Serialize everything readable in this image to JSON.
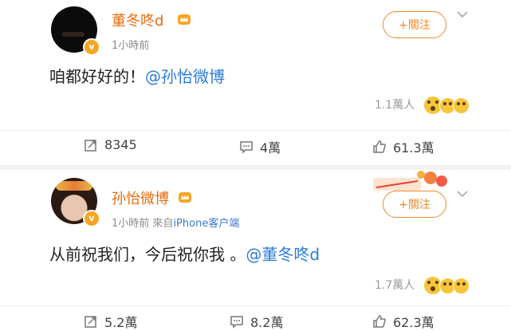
{
  "posts": [
    {
      "author": "董冬咚d",
      "time": "1小時前",
      "follow_label": "+關注",
      "text_prefix": "咱都好好的！",
      "mention": "@孙怡微博",
      "likes": "1.1萬人",
      "actions": {
        "repost": "8345",
        "comment": "4萬",
        "like": "61.3萬"
      }
    },
    {
      "author": "孙怡微博",
      "time": "1小時前",
      "source_prefix": "來自",
      "source_client": "iPhone客户端",
      "follow_label": "+關注",
      "text_prefix": "从前祝我们，今后祝你我 。",
      "mention": "@董冬咚d",
      "likes": "1.7萬人",
      "actions": {
        "repost": "5.2萬",
        "comment": "8.2萬",
        "like": "62.3萬"
      }
    }
  ],
  "colors": {
    "name": "#e86b0d",
    "mention": "#2b7bd8",
    "follow": "#f08a2a"
  }
}
